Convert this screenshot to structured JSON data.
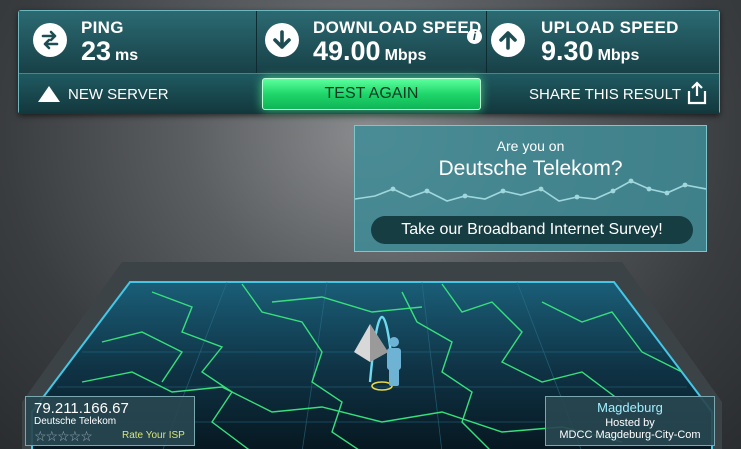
{
  "stats": {
    "ping": {
      "label": "PING",
      "value": "23",
      "unit": "ms"
    },
    "download": {
      "label": "DOWNLOAD SPEED",
      "value": "49.00",
      "unit": "Mbps"
    },
    "upload": {
      "label": "UPLOAD SPEED",
      "value": "9.30",
      "unit": "Mbps"
    }
  },
  "actions": {
    "new_server": "NEW SERVER",
    "test_again": "TEST AGAIN",
    "share": "SHARE THIS RESULT"
  },
  "survey": {
    "question_line1": "Are you on",
    "question_line2": "Deutsche Telekom?",
    "button": "Take our Broadband Internet Survey!"
  },
  "client": {
    "ip": "79.211.166.67",
    "isp": "Deutsche Telekom",
    "stars": "☆☆☆☆☆",
    "rate": "Rate Your ISP"
  },
  "server": {
    "city": "Magdeburg",
    "hosted_by": "Hosted by",
    "host": "MDCC Magdeburg-City-Com"
  },
  "colors": {
    "accent_green": "#1fd66a",
    "panel_teal": "#2b6a72",
    "map_line": "#35e07a"
  }
}
